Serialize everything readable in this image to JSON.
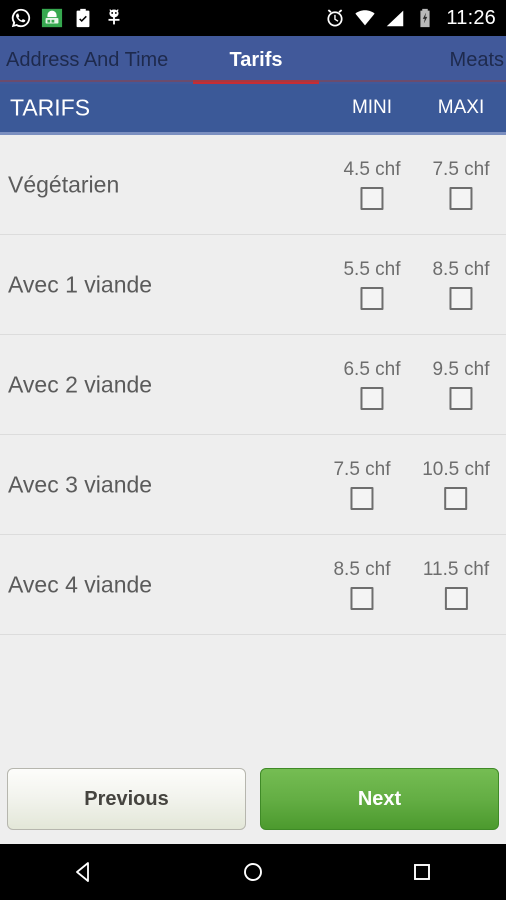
{
  "statusbar": {
    "time": "11:26",
    "left_icons": [
      "whatsapp-icon",
      "green-app-icon",
      "clipboard-check-icon",
      "bug-droid-icon"
    ],
    "right_icons": [
      "alarm-icon",
      "wifi-icon",
      "cell-signal-icon",
      "battery-charging-icon"
    ]
  },
  "tabs": [
    {
      "label": "Address And Time",
      "active": false
    },
    {
      "label": "Tarifs",
      "active": true
    },
    {
      "label": "Meats",
      "active": false
    }
  ],
  "section_header": {
    "title": "TARIFS",
    "col_mini": "MINI",
    "col_maxi": "MAXI"
  },
  "rows": [
    {
      "label": "Végétarien",
      "mini_price": "4.5 chf",
      "maxi_price": "7.5 chf",
      "mini_checked": false,
      "maxi_checked": false
    },
    {
      "label": "Avec 1 viande",
      "mini_price": "5.5 chf",
      "maxi_price": "8.5 chf",
      "mini_checked": false,
      "maxi_checked": false
    },
    {
      "label": "Avec 2 viande",
      "mini_price": "6.5 chf",
      "maxi_price": "9.5 chf",
      "mini_checked": false,
      "maxi_checked": false
    },
    {
      "label": "Avec 3 viande",
      "mini_price": "7.5 chf",
      "maxi_price": "10.5 chf",
      "mini_checked": false,
      "maxi_checked": false
    },
    {
      "label": "Avec 4 viande",
      "mini_price": "8.5 chf",
      "maxi_price": "11.5 chf",
      "mini_checked": false,
      "maxi_checked": false
    }
  ],
  "buttons": {
    "previous": "Previous",
    "next": "Next"
  },
  "navbar": {
    "back": "back-icon",
    "home": "home-icon",
    "recents": "recents-icon"
  },
  "colors": {
    "tabbar_blue": "#41599a",
    "header_blue": "#3b5998",
    "tab_indicator_red": "#c62d35",
    "body_gray": "#eeeeee",
    "next_green": "#64ae44"
  }
}
